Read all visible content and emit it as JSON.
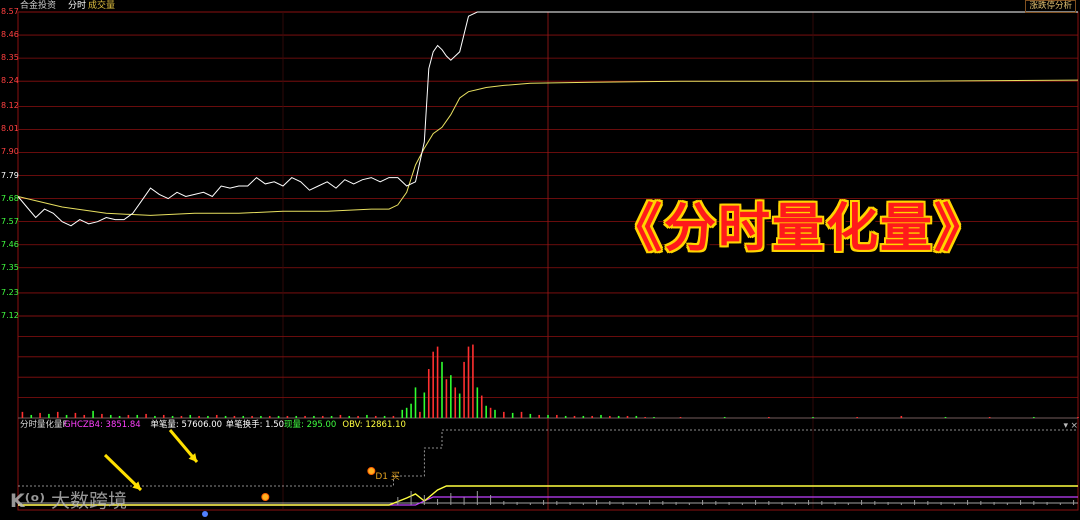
{
  "header": {
    "stock_name": "合金投资",
    "mode_label": "分时",
    "volume_label": "成交量",
    "analysis_button": "涨跌停分析"
  },
  "price_axis": {
    "labels": [
      "8.57",
      "8.46",
      "8.35",
      "8.24",
      "8.12",
      "8.01",
      "7.90",
      "7.79",
      "7.68",
      "7.57",
      "7.46",
      "7.35",
      "7.23",
      "7.12"
    ],
    "base_price": "7.79",
    "colors": {
      "up": "#ff4040",
      "flat": "#ffffff",
      "down": "#40ff40"
    }
  },
  "indicator": {
    "name": "分时量化量F",
    "items": [
      {
        "label": "GHCZB4:",
        "value": "3851.84",
        "color": "#ff40ff"
      },
      {
        "label": "单笔量:",
        "value": "57606.00",
        "color": "#ffffff"
      },
      {
        "label": "单笔换手:",
        "value": "1.50",
        "color": "#ffffff"
      },
      {
        "label": "现量:",
        "value": "295.00",
        "color": "#40ff40"
      },
      {
        "label": "OBV:",
        "value": "12861.10",
        "color": "#ffff40"
      }
    ],
    "marker_text": "D1 买"
  },
  "overlay": {
    "title": "《分时量化量》",
    "watermark": "大数跨境"
  },
  "icons": {
    "dropdown": "chevron-down-icon",
    "close": "close-icon",
    "wm_logo": "brand-logo-icon",
    "arrow": "arrow-icon"
  },
  "colors": {
    "grid_red": "#8a1010",
    "grid_dark": "#3a0a0a",
    "price_line": "#ffffff",
    "avg_line": "#e8e060",
    "obv_line": "#ffff40",
    "ghczb_line": "#c040ff",
    "up_bar": "#ff3030",
    "down_bar": "#30ff30"
  },
  "chart_data": {
    "type": "line",
    "ylim": [
      7.12,
      8.57
    ],
    "xlim": [
      0,
      240
    ],
    "series": [
      {
        "name": "price",
        "x": [
          0,
          2,
          4,
          6,
          8,
          10,
          12,
          14,
          16,
          18,
          20,
          22,
          24,
          26,
          28,
          30,
          32,
          34,
          36,
          38,
          40,
          42,
          44,
          46,
          48,
          50,
          52,
          54,
          56,
          58,
          60,
          62,
          64,
          66,
          68,
          70,
          72,
          74,
          76,
          78,
          80,
          82,
          84,
          86,
          88,
          90,
          92,
          93,
          94,
          95,
          96,
          97,
          98,
          100,
          102,
          104,
          240
        ],
        "y": [
          7.69,
          7.64,
          7.59,
          7.63,
          7.61,
          7.57,
          7.55,
          7.58,
          7.56,
          7.57,
          7.59,
          7.58,
          7.58,
          7.61,
          7.67,
          7.73,
          7.7,
          7.68,
          7.71,
          7.69,
          7.7,
          7.71,
          7.69,
          7.74,
          7.73,
          7.74,
          7.74,
          7.78,
          7.75,
          7.76,
          7.74,
          7.78,
          7.76,
          7.72,
          7.74,
          7.76,
          7.73,
          7.77,
          7.75,
          7.77,
          7.78,
          7.76,
          7.78,
          7.78,
          7.74,
          7.76,
          7.95,
          8.3,
          8.38,
          8.41,
          8.39,
          8.36,
          8.34,
          8.38,
          8.55,
          8.57,
          8.57
        ]
      },
      {
        "name": "average",
        "x": [
          0,
          10,
          20,
          30,
          40,
          50,
          60,
          70,
          80,
          84,
          86,
          88,
          90,
          92,
          94,
          96,
          98,
          100,
          102,
          104,
          106,
          110,
          116,
          130,
          150,
          200,
          240
        ],
        "y": [
          7.69,
          7.64,
          7.61,
          7.6,
          7.61,
          7.61,
          7.62,
          7.62,
          7.63,
          7.63,
          7.65,
          7.71,
          7.84,
          7.92,
          7.99,
          8.02,
          8.08,
          8.16,
          8.19,
          8.2,
          8.21,
          8.22,
          8.23,
          8.235,
          8.24,
          8.24,
          8.245
        ]
      }
    ],
    "volume": {
      "x": [
        1,
        3,
        5,
        7,
        9,
        11,
        13,
        15,
        17,
        19,
        21,
        23,
        25,
        27,
        29,
        31,
        33,
        35,
        37,
        39,
        41,
        43,
        45,
        47,
        49,
        51,
        53,
        55,
        57,
        59,
        61,
        63,
        65,
        67,
        69,
        71,
        73,
        75,
        77,
        79,
        81,
        83,
        85,
        87,
        88,
        89,
        90,
        91,
        92,
        93,
        94,
        95,
        96,
        97,
        98,
        99,
        100,
        101,
        102,
        103,
        104,
        105,
        106,
        107,
        108,
        110,
        112,
        114,
        116,
        118,
        120,
        122,
        124,
        126,
        128,
        130,
        132,
        134,
        136,
        138,
        140,
        142,
        144,
        150,
        160,
        170,
        180,
        190,
        200,
        210,
        220,
        230,
        240
      ],
      "v": [
        6,
        3,
        5,
        4,
        6,
        3,
        5,
        3,
        7,
        4,
        3,
        2,
        3,
        3,
        4,
        2,
        3,
        2,
        2,
        3,
        2,
        2,
        3,
        2,
        2,
        2,
        2,
        2,
        2,
        2,
        2,
        2,
        2,
        2,
        2,
        2,
        3,
        2,
        2,
        3,
        2,
        2,
        2,
        8,
        10,
        14,
        30,
        6,
        25,
        48,
        65,
        70,
        55,
        38,
        42,
        30,
        24,
        55,
        70,
        72,
        30,
        22,
        12,
        10,
        8,
        6,
        5,
        6,
        4,
        3,
        3,
        3,
        2,
        2,
        2,
        2,
        3,
        2,
        2,
        2,
        2,
        1,
        1,
        1,
        1,
        1,
        1,
        1,
        2,
        1,
        1,
        1,
        1
      ],
      "up": [
        true,
        false,
        true,
        false,
        true,
        false,
        true,
        true,
        false,
        true,
        false,
        false,
        true,
        false,
        true,
        false,
        true,
        false,
        true,
        false,
        true,
        false,
        true,
        false,
        true,
        false,
        true,
        false,
        true,
        false,
        true,
        false,
        true,
        false,
        true,
        false,
        true,
        false,
        true,
        false,
        true,
        false,
        true,
        false,
        false,
        false,
        false,
        true,
        false,
        true,
        true,
        true,
        false,
        true,
        false,
        true,
        false,
        true,
        true,
        true,
        false,
        true,
        false,
        true,
        false,
        true,
        false,
        true,
        false,
        true,
        false,
        true,
        false,
        true,
        false,
        true,
        false,
        true,
        false,
        true,
        false,
        true,
        false,
        true,
        false,
        true,
        false,
        true,
        true,
        false,
        true,
        false,
        true
      ]
    }
  }
}
